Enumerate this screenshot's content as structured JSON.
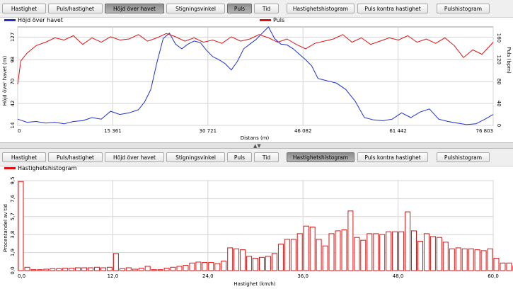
{
  "tabs": [
    "Hastighet",
    "Puls/hastighet",
    "Höjd över havet",
    "Stigningsvinkel",
    "Puls",
    "Tid",
    "Hastighetshistogram",
    "Puls kontra hastighet",
    "Pulshistogram"
  ],
  "top_active": [
    "Höjd över havet",
    "Puls"
  ],
  "bottom_active": [
    "Hastighetshistogram"
  ],
  "colors": {
    "altitude": "#1f2fd0",
    "pulse": "#e01010",
    "hist": "#e01010"
  },
  "top_chart": {
    "legend_altitude": "Höjd över havet",
    "legend_pulse": "Puls",
    "xlabel": "Distans (m)",
    "ylabel_left": "Höjd över havet (m)",
    "ylabel_right": "Puls (bpm)",
    "x_ticks": [
      "0",
      "15 361",
      "30 721",
      "46 082",
      "61 442",
      "76 803"
    ],
    "y_left_ticks": [
      "14",
      "42",
      "70",
      "98",
      "127"
    ],
    "y_right_ticks": [
      "0",
      "40",
      "80",
      "120",
      "160"
    ]
  },
  "bottom_chart": {
    "legend": "Hastighetshistogram",
    "xlabel": "Hastighet (km/h)",
    "ylabel": "Procentandel av tid",
    "x_ticks": [
      "0,0",
      "12,0",
      "24,0",
      "36,0",
      "48,0",
      "60,0"
    ],
    "y_ticks": [
      "0,0",
      "1,9",
      "3,8",
      "5,7",
      "7,6",
      "9,5"
    ]
  },
  "chart_data": [
    {
      "type": "line",
      "xlim": [
        0,
        76803
      ],
      "series": [
        {
          "name": "Höjd över havet",
          "axis": "left",
          "ylim": [
            14,
            140
          ],
          "x": [
            0,
            1500,
            3000,
            4500,
            6000,
            7500,
            9000,
            10500,
            12000,
            13500,
            15000,
            16500,
            18000,
            19500,
            20500,
            21500,
            22500,
            23500,
            24500,
            25500,
            26500,
            27500,
            28500,
            29500,
            30500,
            31500,
            32500,
            33500,
            34500,
            35500,
            36500,
            37500,
            38500,
            39500,
            40500,
            41500,
            42500,
            43500,
            44500,
            45500,
            46500,
            47500,
            48500,
            49500,
            50500,
            51500,
            53000,
            54500,
            56000,
            57500,
            59000,
            60500,
            62000,
            63500,
            65000,
            66500,
            68000,
            69500,
            71000,
            72500,
            74000,
            75500,
            76803
          ],
          "values": [
            22,
            18,
            19,
            17,
            18,
            16,
            19,
            20,
            24,
            22,
            32,
            28,
            30,
            34,
            44,
            60,
            95,
            125,
            132,
            118,
            112,
            118,
            122,
            120,
            110,
            102,
            98,
            93,
            85,
            96,
            112,
            118,
            124,
            132,
            140,
            125,
            118,
            117,
            112,
            105,
            98,
            90,
            74,
            72,
            70,
            68,
            60,
            45,
            24,
            21,
            20,
            22,
            30,
            24,
            31,
            35,
            22,
            19,
            17,
            15,
            16,
            22,
            28
          ]
        },
        {
          "name": "Puls",
          "axis": "right",
          "ylim": [
            0,
            180
          ],
          "x": [
            0,
            500,
            1500,
            3000,
            4500,
            6000,
            7500,
            9000,
            10500,
            12000,
            13500,
            15000,
            16500,
            18000,
            19500,
            21000,
            22500,
            24000,
            25500,
            27000,
            28500,
            30000,
            31500,
            33000,
            34500,
            36000,
            37500,
            39000,
            40500,
            42000,
            43500,
            45000,
            46500,
            48000,
            49500,
            51000,
            52500,
            54000,
            55500,
            57000,
            58500,
            60000,
            61500,
            63000,
            64500,
            66000,
            67500,
            69000,
            70500,
            72000,
            73500,
            75000,
            76803
          ],
          "values": [
            75,
            118,
            132,
            146,
            152,
            160,
            156,
            164,
            148,
            160,
            152,
            162,
            156,
            158,
            166,
            154,
            160,
            168,
            162,
            154,
            160,
            152,
            156,
            150,
            162,
            154,
            158,
            166,
            160,
            152,
            158,
            148,
            140,
            150,
            154,
            158,
            166,
            152,
            160,
            148,
            154,
            160,
            156,
            164,
            152,
            158,
            150,
            160,
            146,
            124,
            138,
            130,
            152
          ]
        }
      ]
    },
    {
      "type": "bar",
      "xlabel": "Hastighet (km/h)",
      "ylabel": "Procentandel av tid",
      "xlim": [
        0,
        60
      ],
      "ylim": [
        0,
        9.5
      ],
      "bin_width": 0.8,
      "values": [
        9.4,
        0.35,
        0.1,
        0.1,
        0.15,
        0.2,
        0.2,
        0.25,
        0.25,
        0.3,
        0.3,
        0.3,
        0.35,
        0.3,
        0.35,
        1.8,
        0.2,
        0.3,
        0.15,
        0.25,
        0.45,
        0.1,
        0.1,
        0.25,
        0.35,
        0.45,
        0.55,
        0.8,
        0.9,
        0.85,
        0.85,
        0.75,
        1.0,
        2.4,
        2.3,
        2.2,
        1.5,
        1.3,
        1.4,
        1.5,
        1.8,
        2.8,
        3.3,
        3.3,
        3.9,
        4.7,
        4.6,
        3.3,
        2.6,
        3.9,
        4.2,
        4.3,
        6.3,
        3.5,
        3.2,
        3.9,
        3.9,
        3.8,
        4.1,
        4.1,
        4.1,
        6.2,
        4.2,
        3.1,
        3.9,
        3.6,
        3.5,
        3.0,
        2.3,
        2.4,
        2.3,
        2.3,
        2.2,
        2.1,
        2.3,
        1.3,
        0.8,
        0.8,
        0.5,
        0.45,
        0.35,
        0.35,
        0.3,
        0.2,
        0.15,
        0.15,
        0.1,
        0.1,
        0.1,
        0.05,
        0.05,
        0.05,
        0.05,
        0.05,
        0.05
      ]
    }
  ]
}
